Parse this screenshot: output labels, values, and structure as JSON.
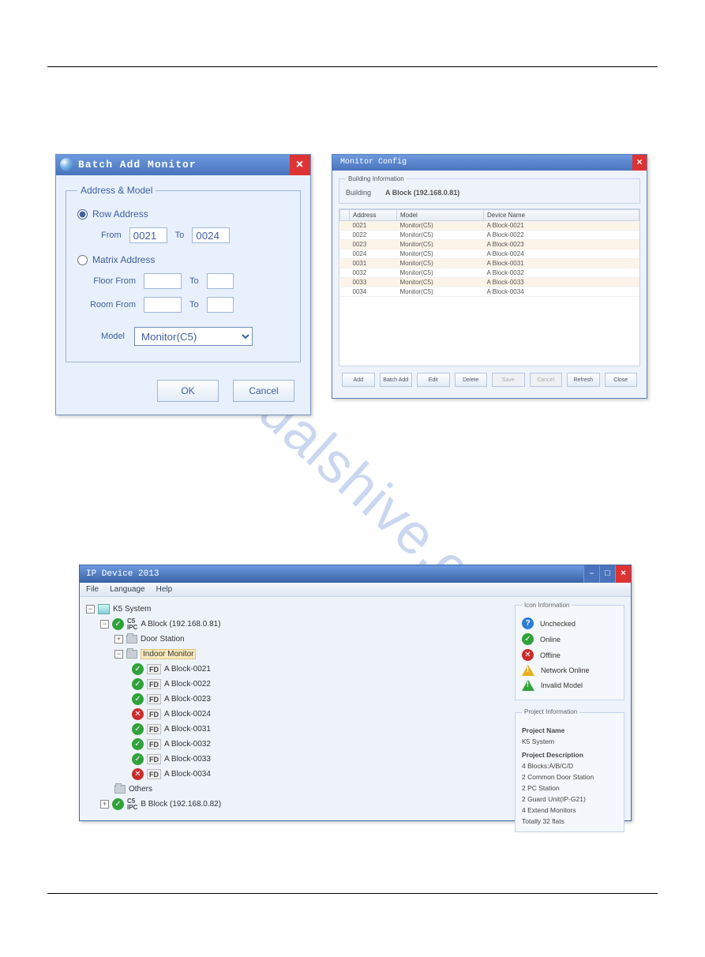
{
  "watermark": "manualshive.com",
  "dlg1": {
    "title": "Batch Add Monitor",
    "legend": "Address & Model",
    "row_radio": "Row Address",
    "from": "From",
    "to": "To",
    "from_val": "0021",
    "to_val": "0024",
    "matrix_radio": "Matrix Address",
    "floor_from": "Floor From",
    "room_from": "Room From",
    "model": "Model",
    "model_val": "Monitor(C5)",
    "ok": "OK",
    "cancel": "Cancel"
  },
  "dlg2": {
    "title": "Monitor Config",
    "build_legend": "Building Information",
    "building_lbl": "Building",
    "building_val": "A Block (192.168.0.81)",
    "cols": {
      "addr": "Address",
      "model": "Model",
      "name": "Device Name"
    },
    "rows": [
      {
        "a": "0021",
        "m": "Monitor(C5)",
        "n": "A Block-0021"
      },
      {
        "a": "0022",
        "m": "Monitor(C5)",
        "n": "A Block-0022"
      },
      {
        "a": "0023",
        "m": "Monitor(C5)",
        "n": "A Block-0023"
      },
      {
        "a": "0024",
        "m": "Monitor(C5)",
        "n": "A Block-0024"
      },
      {
        "a": "0031",
        "m": "Monitor(C5)",
        "n": "A Block-0031"
      },
      {
        "a": "0032",
        "m": "Monitor(C5)",
        "n": "A Block-0032"
      },
      {
        "a": "0033",
        "m": "Monitor(C5)",
        "n": "A Block-0033"
      },
      {
        "a": "0034",
        "m": "Monitor(C5)",
        "n": "A Block-0034"
      }
    ],
    "btns": {
      "add": "Add",
      "batch": "Batch Add",
      "edit": "Edit",
      "del": "Delete",
      "save": "Save",
      "cancel": "Cancel",
      "refresh": "Refresh",
      "close": "Close"
    }
  },
  "win3": {
    "title": "IP Device 2013",
    "menu": {
      "file": "File",
      "lang": "Language",
      "help": "Help"
    },
    "root": "K5 System",
    "blockA": "A Block (192.168.0.81)",
    "door": "Door Station",
    "indoor": "Indoor Monitor",
    "monitors": [
      {
        "ok": true,
        "name": "A Block-0021"
      },
      {
        "ok": true,
        "name": "A Block-0022"
      },
      {
        "ok": true,
        "name": "A Block-0023"
      },
      {
        "ok": false,
        "name": "A Block-0024"
      },
      {
        "ok": true,
        "name": "A Block-0031"
      },
      {
        "ok": true,
        "name": "A Block-0032"
      },
      {
        "ok": true,
        "name": "A Block-0033"
      },
      {
        "ok": false,
        "name": "A Block-0034"
      }
    ],
    "others": "Others",
    "blockB": "B Block (192.168.0.82)",
    "legend_title": "Icon Information",
    "legend": {
      "unchecked": "Unchecked",
      "online": "Online",
      "offline": "Offline",
      "netonline": "Network Online",
      "invalid": "Invalid Model"
    },
    "proj_title": "Project Information",
    "proj_name_lbl": "Project Name",
    "proj_name": "K5 System",
    "proj_desc_lbl": "Project Description",
    "proj_desc": [
      "4 Blocks:A/B/C/D",
      "2 Common Door Station",
      "2 PC Station",
      "2 Guard Unit(IP-G21)",
      "4 Extend Monitors",
      "Totally 32 flats"
    ]
  }
}
